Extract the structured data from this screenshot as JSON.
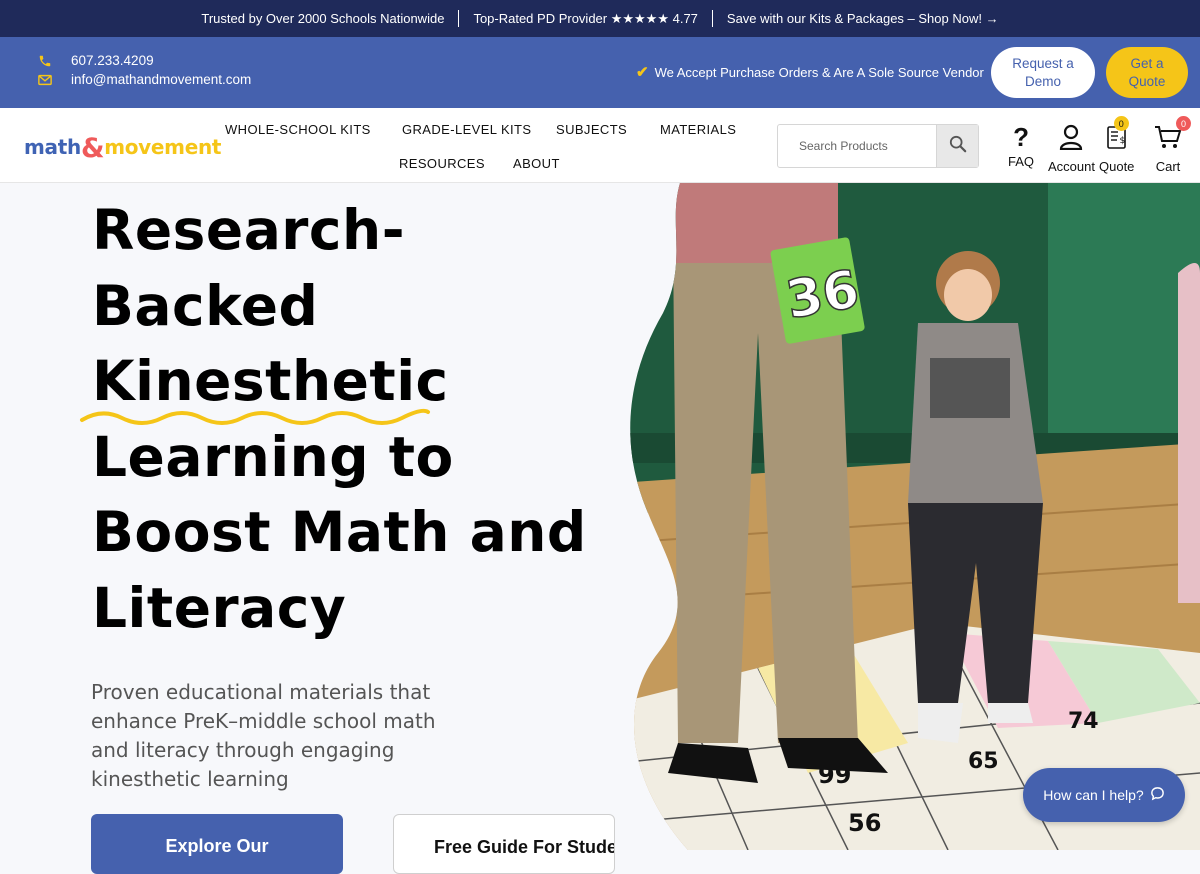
{
  "announcement": {
    "item1": "Trusted by Over 2000 Schools Nationwide",
    "item2": "Top-Rated PD Provider ★★★★★ 4.77",
    "item3": "Save with our Kits & Packages – Shop Now! →"
  },
  "contact": {
    "phone": "607.233.4209",
    "email": "info@mathandmovement.com",
    "vendor_note": "We Accept Purchase Orders & Are A Sole Source Vendor",
    "demo_line1": "Request a",
    "demo_line2": "Demo",
    "quote_line1": "Get a",
    "quote_line2": "Quote"
  },
  "brand": {
    "logo_part1": "math",
    "logo_amp": "&",
    "logo_part2": "movement",
    "colors": {
      "navy": "#1f2a5a",
      "blue": "#4561ae",
      "yellow": "#f5c518",
      "coral": "#ef5a5a"
    }
  },
  "nav": {
    "items": [
      "WHOLE-SCHOOL KITS",
      "GRADE-LEVEL KITS",
      "SUBJECTS",
      "MATERIALS",
      "RESOURCES",
      "ABOUT"
    ],
    "search_placeholder": "Search Products",
    "faq": "FAQ",
    "account": "Account",
    "quote": "Quote",
    "quote_count": "0",
    "cart": "Cart",
    "cart_count": "0"
  },
  "hero": {
    "title_lines": [
      "Research-",
      "Backed",
      "Kinesthetic",
      "Learning to",
      "Boost Math and",
      "Literacy"
    ],
    "highlighted_line": "Kinesthetic",
    "subtitle": "Proven educational materials that enhance PreK–middle school math and literacy through engaging kinesthetic learning",
    "btn_explore": "Explore Our",
    "btn_guide": "Free Guide For Stude",
    "photo_card_number": "36"
  },
  "chat": {
    "label": "How can I help?"
  }
}
